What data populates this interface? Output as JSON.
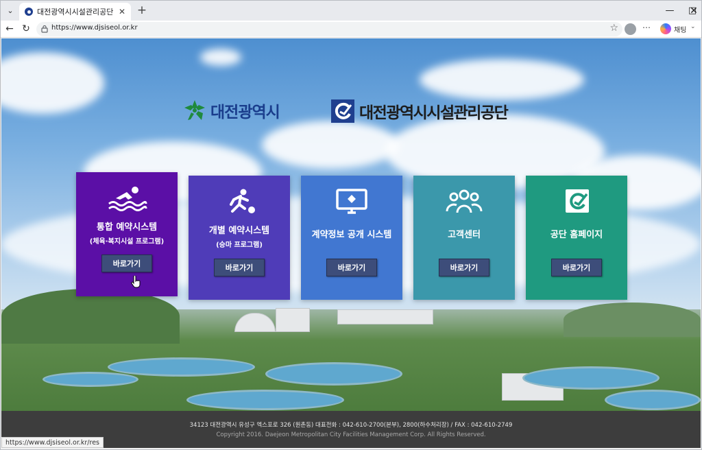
{
  "browser": {
    "tab_title": "대전광역시시설관리공단",
    "url": "https://www.djsiseol.or.kr",
    "chat_label": "채팅",
    "status_url": "https://www.djsiseol.or.kr/res"
  },
  "header": {
    "city_logo_text": "대전광역시",
    "corp_logo_text": "대전광역시시설관리공단"
  },
  "cards": [
    {
      "title": "통합 예약시스템",
      "subtitle": "(체육·복지시설 프로그램)",
      "button": "바로가기",
      "color": "#5b0fa6",
      "icon": "swimmer-icon"
    },
    {
      "title": "개별 예약시스템",
      "subtitle": "(승마 프로그램)",
      "button": "바로가기",
      "color": "#4f3cb8",
      "icon": "runner-icon"
    },
    {
      "title": "계약정보 공개 시스템",
      "subtitle": "",
      "button": "바로가기",
      "color": "#4177d1",
      "icon": "monitor-icon"
    },
    {
      "title": "고객센터",
      "subtitle": "",
      "button": "바로가기",
      "color": "#3b98ab",
      "icon": "people-icon"
    },
    {
      "title": "공단 홈페이지",
      "subtitle": "",
      "button": "바로가기",
      "color": "#1f9a80",
      "icon": "corp-logo-icon"
    }
  ],
  "footer": {
    "address": "34123 대전광역시 유성구 엑스포로 326 (원촌동) 대표전화 : 042-610-2700(본부), 2800(하수처리장) / FAX : 042-610-2749",
    "copyright": "Copyright 2016. Daejeon Metropolitan City Facilities Management Corp. All Rights Reserved."
  }
}
